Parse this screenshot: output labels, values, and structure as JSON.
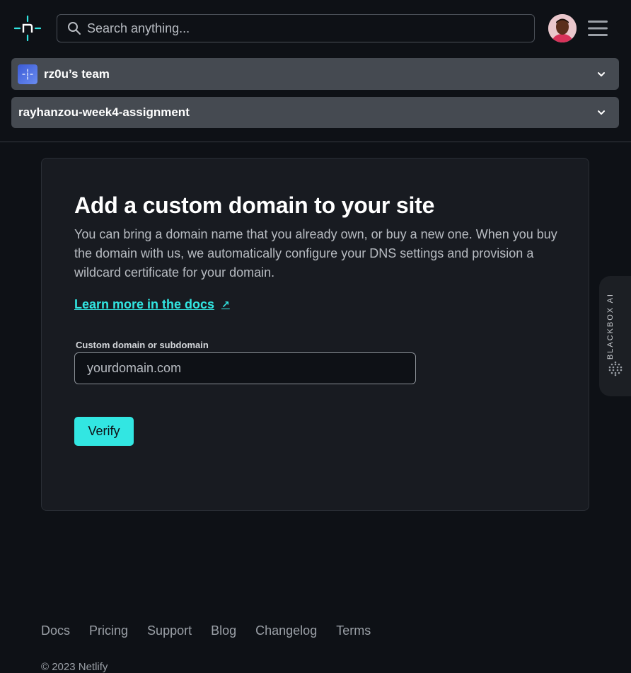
{
  "header": {
    "search_placeholder": "Search anything...",
    "avatar_label": "user avatar"
  },
  "team_selector": {
    "label": "rz0u’s team"
  },
  "site_selector": {
    "label": "rayhanzou-week4-assignment"
  },
  "card": {
    "title": "Add a custom domain to your site",
    "description": "You can bring a domain name that you already own, or buy a new one. When you buy the domain with us, we automatically configure your DNS settings and provision a wildcard certificate for your domain.",
    "docs_link": "Learn more in the docs",
    "docs_arrow": "↗",
    "field_label": "Custom domain or subdomain",
    "field_placeholder": "yourdomain.com",
    "verify_label": "Verify"
  },
  "side_widget": {
    "label": "BLACKBOX AI"
  },
  "footer": {
    "links": [
      "Docs",
      "Pricing",
      "Support",
      "Blog",
      "Changelog",
      "Terms"
    ],
    "copyright": "© 2023 Netlify"
  },
  "colors": {
    "accent": "#32e6e2",
    "background": "#0e1116",
    "card": "#181b21",
    "selector": "#454a51"
  }
}
